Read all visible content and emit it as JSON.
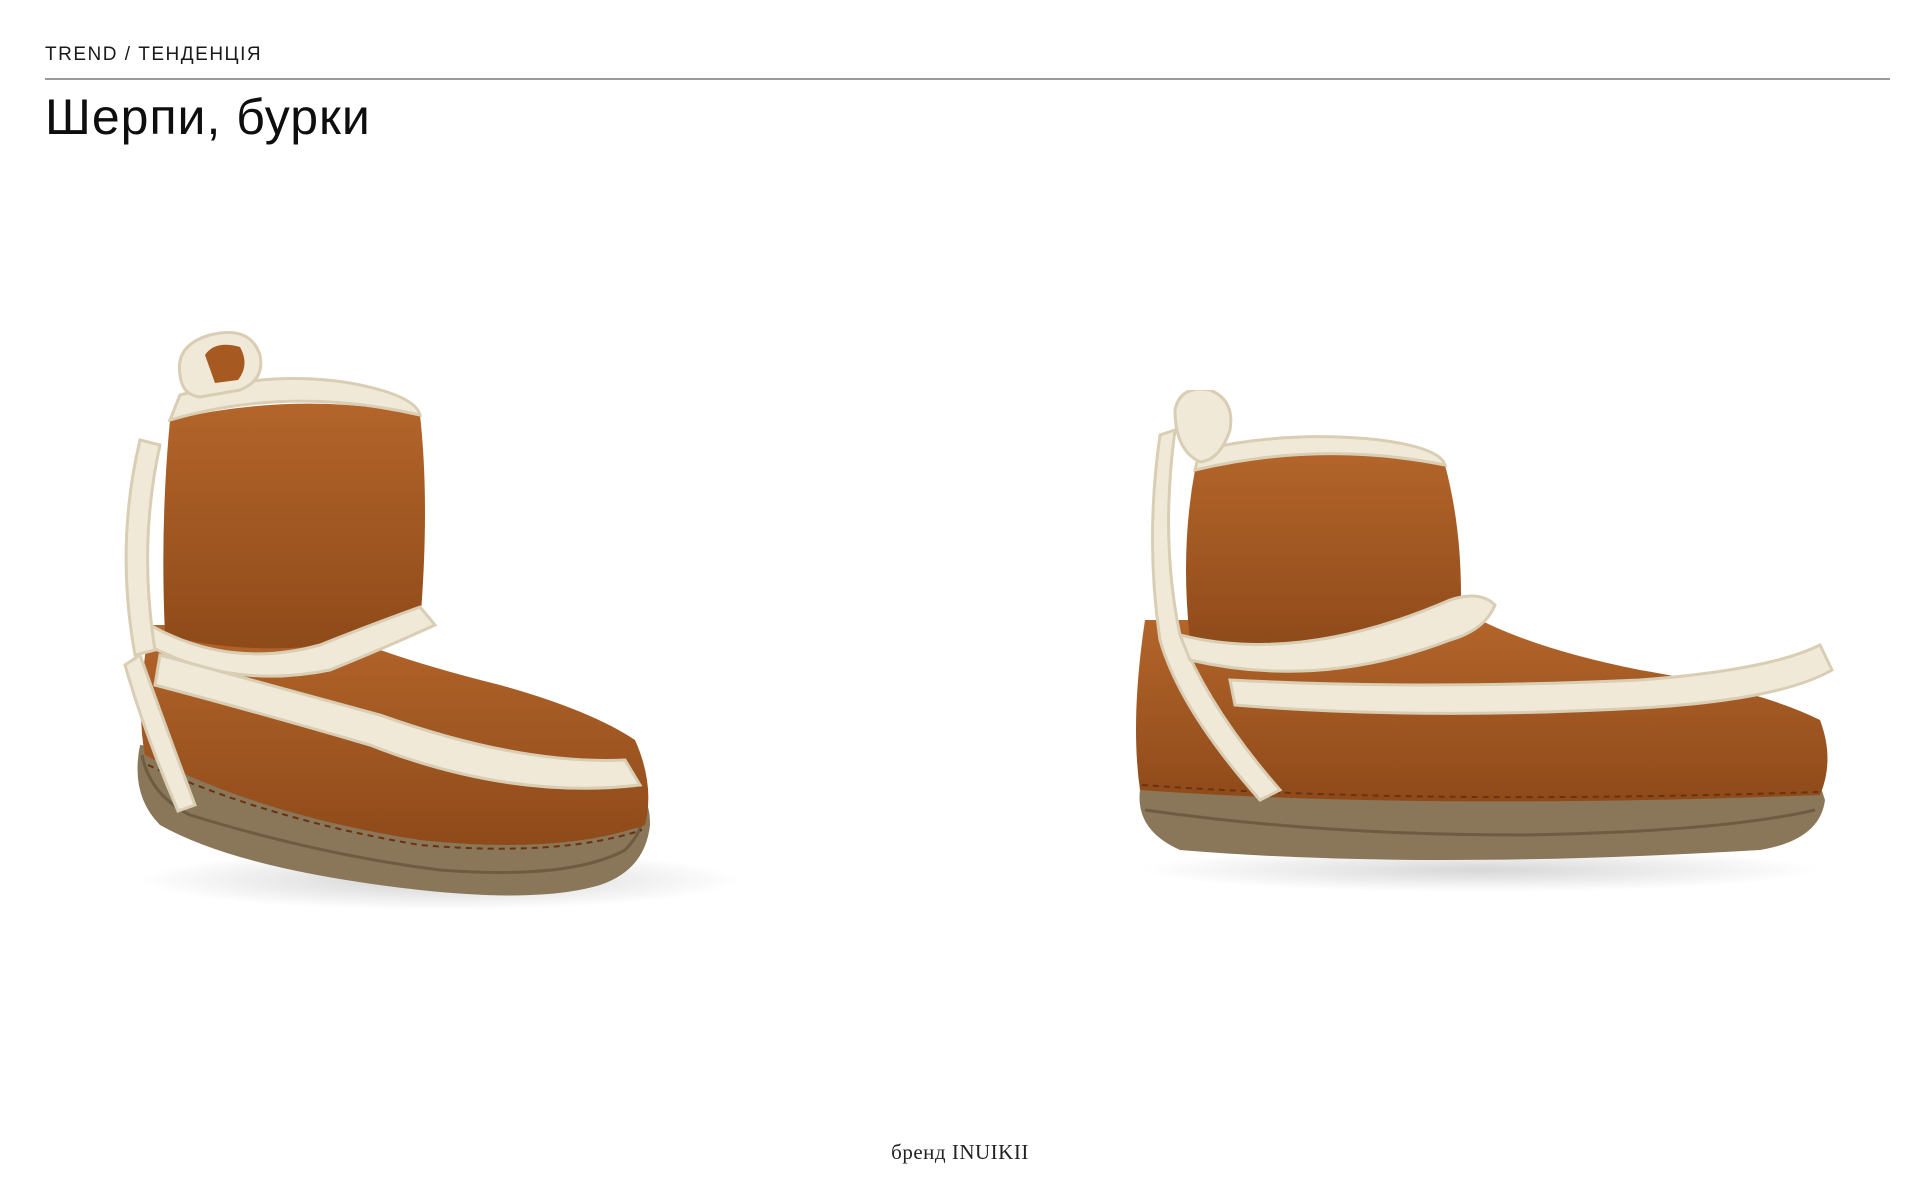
{
  "header": {
    "kicker": "TREND / ТЕНДЕНЦІЯ",
    "title": "Шерпи, бурки"
  },
  "products": [
    {
      "image_subject": "boot-three-quarter-view-icon"
    },
    {
      "image_subject": "boot-side-view-icon"
    }
  ],
  "footer": {
    "caption": "бренд INUIKII"
  },
  "colors": {
    "suede": "#a65a22",
    "suede_dark": "#7e3f14",
    "shearling": "#f1e9d8",
    "sole": "#8a7658",
    "rule": "#9a9a9a"
  }
}
